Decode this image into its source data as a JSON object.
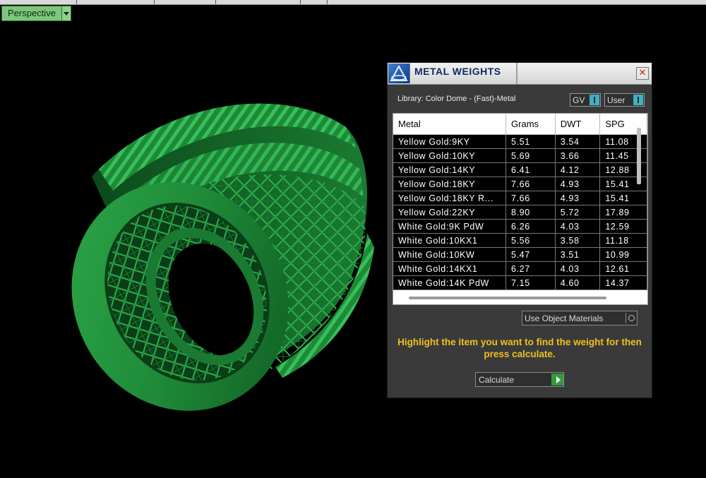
{
  "viewport": {
    "label": "Perspective"
  },
  "panel": {
    "title": "METAL WEIGHTS",
    "close_glyph": "✕",
    "library_label": "Library: Color Dome - (Fast)-Metal",
    "toggle_gv": "GV",
    "toggle_user": "User",
    "columns": [
      "Metal",
      "Grams",
      "DWT",
      "SPG"
    ],
    "rows": [
      {
        "metal": "Yellow Gold:9KY",
        "grams": "5.51",
        "dwt": "3.54",
        "spg": "11.08"
      },
      {
        "metal": "Yellow Gold:10KY",
        "grams": "5.69",
        "dwt": "3.66",
        "spg": "11.45"
      },
      {
        "metal": "Yellow Gold:14KY",
        "grams": "6.41",
        "dwt": "4.12",
        "spg": "12.88"
      },
      {
        "metal": "Yellow Gold:18KY",
        "grams": "7.66",
        "dwt": "4.93",
        "spg": "15.41"
      },
      {
        "metal": "Yellow Gold:18KY R...",
        "grams": "7.66",
        "dwt": "4.93",
        "spg": "15.41"
      },
      {
        "metal": "Yellow Gold:22KY",
        "grams": "8.90",
        "dwt": "5.72",
        "spg": "17.89"
      },
      {
        "metal": "White Gold:9K PdW",
        "grams": "6.26",
        "dwt": "4.03",
        "spg": "12.59"
      },
      {
        "metal": "White Gold:10KX1",
        "grams": "5.56",
        "dwt": "3.58",
        "spg": "11.18"
      },
      {
        "metal": "White Gold:10KW",
        "grams": "5.47",
        "dwt": "3.51",
        "spg": "10.99"
      },
      {
        "metal": "White Gold:14KX1",
        "grams": "6.27",
        "dwt": "4.03",
        "spg": "12.61"
      },
      {
        "metal": "White Gold:14K PdW",
        "grams": "7.15",
        "dwt": "4.60",
        "spg": "14.37"
      }
    ],
    "use_object_materials": "Use Object Materials",
    "hint": "Highlight the item you want to find the weight for then press calculate.",
    "calculate_label": "Calculate"
  },
  "colors": {
    "ring": "#1f8a3a",
    "hint": "#f0c020",
    "toggle_knob": "#3fb0c6"
  }
}
